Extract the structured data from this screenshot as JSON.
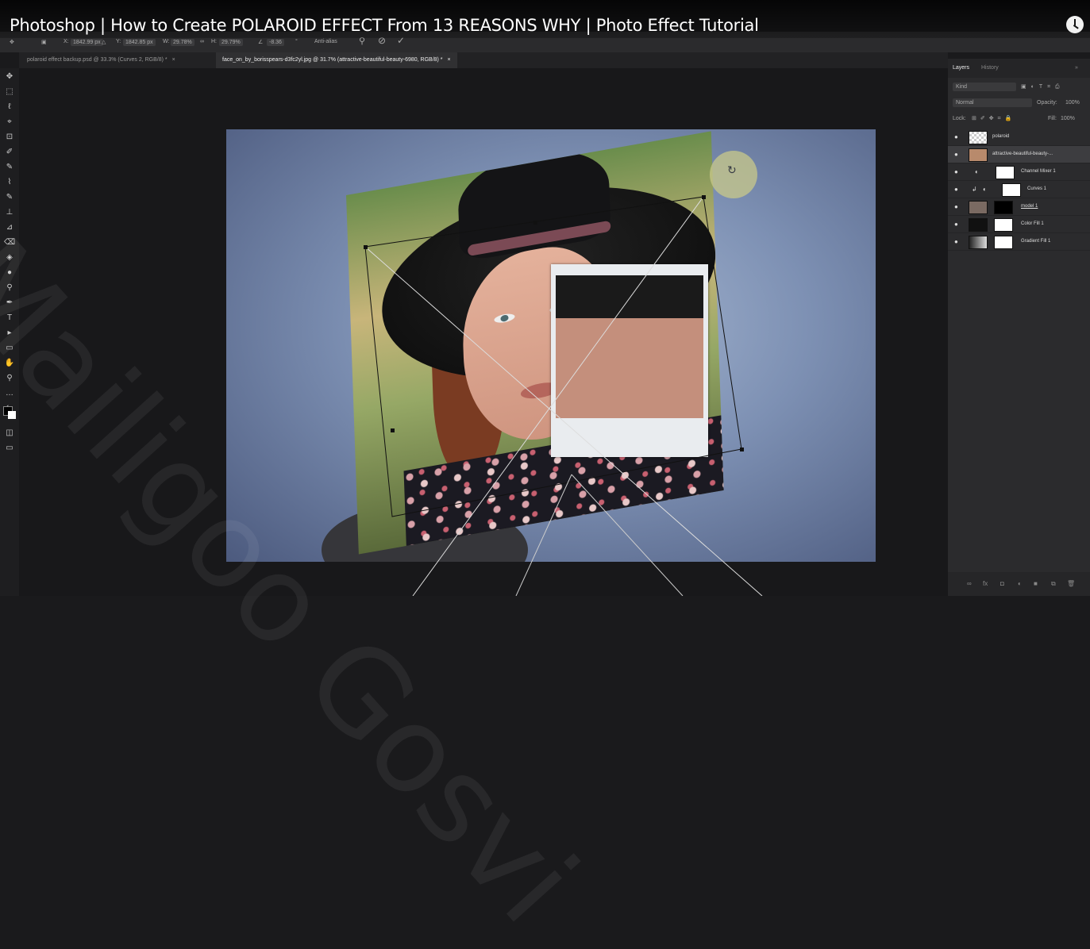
{
  "video": {
    "title": "Photoshop | How to Create POLAROID EFFECT From 13 REASONS WHY | Photo Effect Tutorial"
  },
  "options_bar": {
    "x_label": "X:",
    "x_value": "1842.99 px",
    "y_label": "Y:",
    "y_value": "1842.85 px",
    "w_label": "W:",
    "w_value": "29.78%",
    "h_label": "H:",
    "h_value": "29.79%",
    "angle_value": "-8.36",
    "angle_unit": "°",
    "antialias_label": "Anti-alias",
    "cancel_label": "⊘",
    "commit_label": "✓"
  },
  "document_tabs": [
    {
      "label": "polaroid effect backup.psd @ 33.3% (Curves 2, RGB/8) *",
      "close": "×"
    },
    {
      "label": "face_on_by_borisspears-d3fc2yl.jpg @ 31.7% (attractive-beautiful-beauty-6980, RGB/8) *",
      "close": "×"
    }
  ],
  "tools": [
    "✥",
    "⬚",
    "ℓ",
    "⌖",
    "⊡",
    "✐",
    "✎",
    "⌇",
    "✎",
    "⊥",
    "⊿",
    "⌫",
    "◈",
    "●",
    "⚲",
    "✒",
    "T",
    "▸",
    "▭",
    "✋",
    "⚲",
    "…",
    "⇆"
  ],
  "watermark": {
    "text": "Mailigoo Gosvi"
  },
  "panel": {
    "tabs": [
      "Layers",
      "History"
    ],
    "tab_menu": "»",
    "kind_label": "Kind",
    "blend_mode": "Normal",
    "opacity_label": "Opacity:",
    "opacity_value": "100%",
    "lock_label": "Lock:",
    "fill_label": "Fill:",
    "fill_value": "100%",
    "layers": [
      {
        "name": "polaroid"
      },
      {
        "name": "attractive-beautiful-beauty-..."
      },
      {
        "name": "Channel Mixer 1"
      },
      {
        "name": "Curves 1"
      },
      {
        "name": "model 1"
      },
      {
        "name": "Color Fill 1"
      },
      {
        "name": "Gradient Fill 1"
      }
    ],
    "footer_icons": [
      "link-icon",
      "fx-icon",
      "mask-icon",
      "adjustment-icon",
      "group-icon",
      "new-layer-icon",
      "trash-icon"
    ],
    "footer_glyphs": [
      "∞",
      "fx",
      "◘",
      "◐",
      "■",
      "⧉",
      "🗑"
    ]
  },
  "colors": {
    "accent": "#c9c98a",
    "canvas_bg": "#18181a",
    "panel_bg": "#2b2b2d"
  }
}
